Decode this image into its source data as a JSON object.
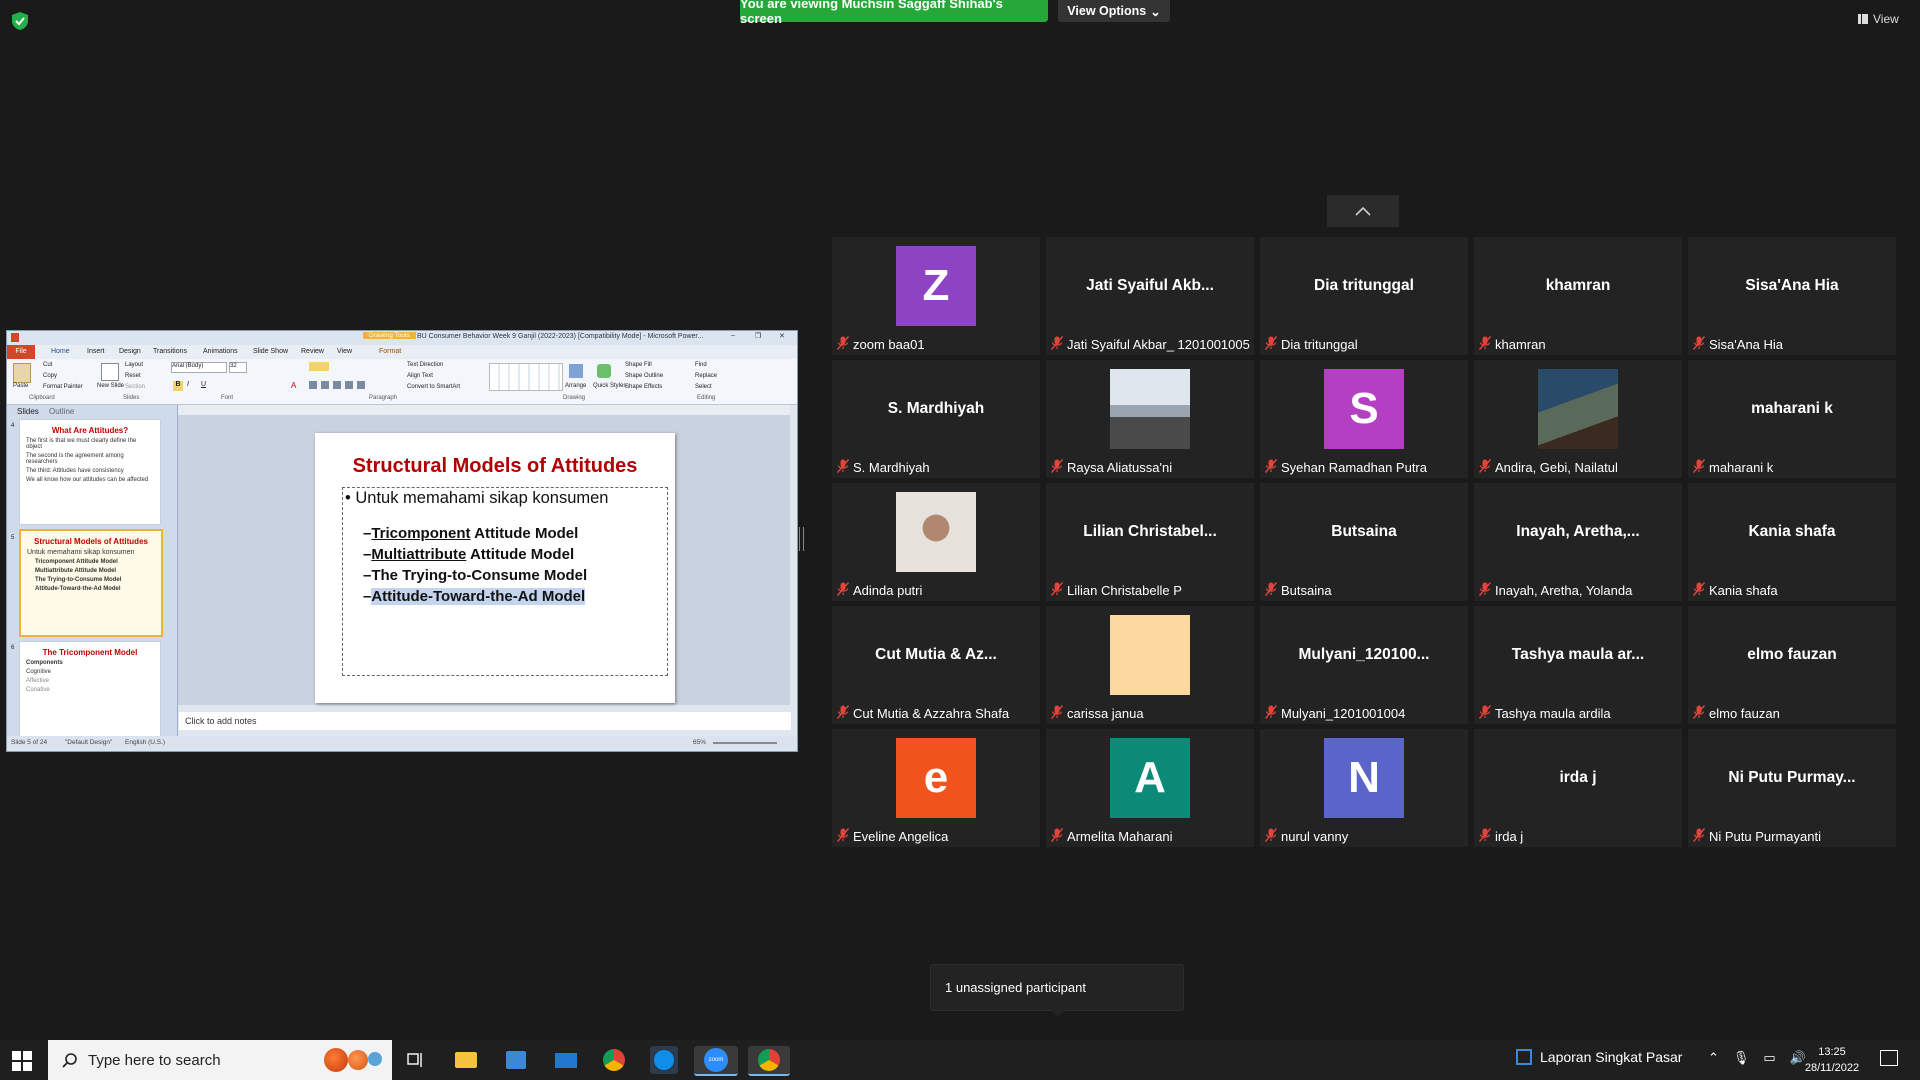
{
  "zoom": {
    "share_banner": "You are viewing Muchsin Saggaff Shihab's screen",
    "view_options_label": "View Options",
    "view_button_label": "View",
    "unassigned_label": "1 unassigned participant"
  },
  "ppt": {
    "window_title": "BU Consumer Behavior Week 9 Ganjil (2022-2023) [Compatibility Mode] - Microsoft Power...",
    "drawing_tools": "Drawing Tools",
    "tabs": [
      "File",
      "Home",
      "Insert",
      "Design",
      "Transitions",
      "Animations",
      "Slide Show",
      "Review",
      "View",
      "Format"
    ],
    "groups": [
      "Clipboard",
      "Slides",
      "Font",
      "Paragraph",
      "Drawing",
      "Editing"
    ],
    "font_name": "Arial (Body)",
    "font_size": "32",
    "ribbon_labels": {
      "paste": "Paste",
      "cut": "Cut",
      "copy": "Copy",
      "format_painter": "Format Painter",
      "new_slide": "New Slide",
      "layout": "Layout",
      "reset": "Reset",
      "section": "Section",
      "text_direction": "Text Direction",
      "align_text": "Align Text",
      "convert_smartart": "Convert to SmartArt",
      "arrange": "Arrange",
      "quick_styles": "Quick Styles",
      "shape_fill": "Shape Fill",
      "shape_outline": "Shape Outline",
      "shape_effects": "Shape Effects",
      "find": "Find",
      "replace": "Replace",
      "select": "Select"
    },
    "panel_tabs": [
      "Slides",
      "Outline"
    ],
    "thumbnails": [
      {
        "num": "4",
        "title": "What Are Attitudes?",
        "lines": [
          "The first is that we must clearly define the object",
          "The second is the agreement among researchers",
          "The third: Attitudes have consistency",
          "We all know how our attitudes can be affected"
        ]
      },
      {
        "num": "5",
        "title": "Structural Models of Attitudes",
        "lines": [
          "Untuk memahami sikap konsumen",
          "Tricomponent Attitude Model",
          "Multiattribute Attitude Model",
          "The Trying-to-Consume Model",
          "Attitude-Toward-the-Ad Model"
        ]
      },
      {
        "num": "6",
        "title": "The Tricomponent Model",
        "lines": [
          "Components",
          "Cognitive",
          "Affective",
          "Conative"
        ]
      }
    ],
    "slide": {
      "title": "Structural Models of Attitudes",
      "bullet": "Untuk memahami sikap konsumen",
      "subs": [
        {
          "u": "Tricomponent",
          "rest": " Attitude Model"
        },
        {
          "u": "Multiattribute",
          "rest": " Attitude Model"
        },
        {
          "u": "",
          "rest": "The Trying-to-Consume Model"
        },
        {
          "u": "",
          "rest": "Attitude-Toward-the-Ad Model"
        }
      ]
    },
    "notes_placeholder": "Click to add notes",
    "status": {
      "slide": "Slide 5 of 24",
      "theme": "\"Default Design\"",
      "language": "English (U.S.)",
      "zoom": "65%"
    }
  },
  "tiles": [
    {
      "title": "",
      "name": "zoom baa01",
      "avatar": {
        "letter": "Z",
        "color": "#8e44c2"
      }
    },
    {
      "title": "Jati Syaiful Akb...",
      "name": "Jati Syaiful Akbar_ 1201001005"
    },
    {
      "title": "Dia tritunggal",
      "name": "Dia tritunggal"
    },
    {
      "title": "khamran",
      "name": "khamran"
    },
    {
      "title": "Sisa'Ana Hia",
      "name": "Sisa'Ana Hia"
    },
    {
      "title": "S. Mardhiyah",
      "name": "S. Mardhiyah"
    },
    {
      "title": "",
      "name": "Raysa Aliatussa'ni",
      "photo": "pier"
    },
    {
      "title": "",
      "name": "Syehan Ramadhan Putra",
      "avatar": {
        "letter": "S",
        "color": "#b53fc2"
      }
    },
    {
      "title": "",
      "name": "Andira, Gebi, Nailatul",
      "photo": "building"
    },
    {
      "title": "maharani k",
      "name": "maharani k"
    },
    {
      "title": "",
      "name": "Adinda putri",
      "photo": "person"
    },
    {
      "title": "Lilian  Christabel...",
      "name": "Lilian Christabelle P"
    },
    {
      "title": "Butsaina",
      "name": "Butsaina"
    },
    {
      "title": "Inayah,  Aretha,...",
      "name": "Inayah, Aretha, Yolanda"
    },
    {
      "title": "Kania shafa",
      "name": "Kania shafa"
    },
    {
      "title": "Cut Mutia & Az...",
      "name": "Cut Mutia & Azzahra Shafa"
    },
    {
      "title": "",
      "name": "carissa janua",
      "avatar": {
        "letter": "",
        "color": "#fdd9a0"
      }
    },
    {
      "title": "Mulyani_120100...",
      "name": "Mulyani_1201001004"
    },
    {
      "title": "Tashya maula ar...",
      "name": "Tashya maula ardila"
    },
    {
      "title": "elmo fauzan",
      "name": "elmo fauzan"
    },
    {
      "title": "",
      "name": "Eveline Angelica",
      "avatar": {
        "letter": "e",
        "color": "#f0531c"
      }
    },
    {
      "title": "",
      "name": "Armelita Maharani",
      "avatar": {
        "letter": "A",
        "color": "#0b8a78"
      }
    },
    {
      "title": "",
      "name": "nurul vanny",
      "avatar": {
        "letter": "N",
        "color": "#5a64c9"
      }
    },
    {
      "title": "irda j",
      "name": "irda j"
    },
    {
      "title": "Ni Putu Purmay...",
      "name": "Ni Putu Purmayanti"
    }
  ],
  "taskbar": {
    "search_placeholder": "Type here to search",
    "pinned_window": "Laporan Singkat Pasar",
    "time": "13:25",
    "date": "28/11/2022",
    "zoom_app_label": "zoom",
    "icons": [
      "task-view-icon",
      "file-explorer-icon",
      "store-icon",
      "mail-icon",
      "chrome-icon",
      "teamviewer-icon",
      "zoom-icon",
      "chrome-profile-icon"
    ]
  },
  "colors": {
    "share_green": "#26a73a",
    "mute_red": "#e0443b",
    "slide_title_red": "#b00000",
    "tile_bg": "#232323"
  }
}
